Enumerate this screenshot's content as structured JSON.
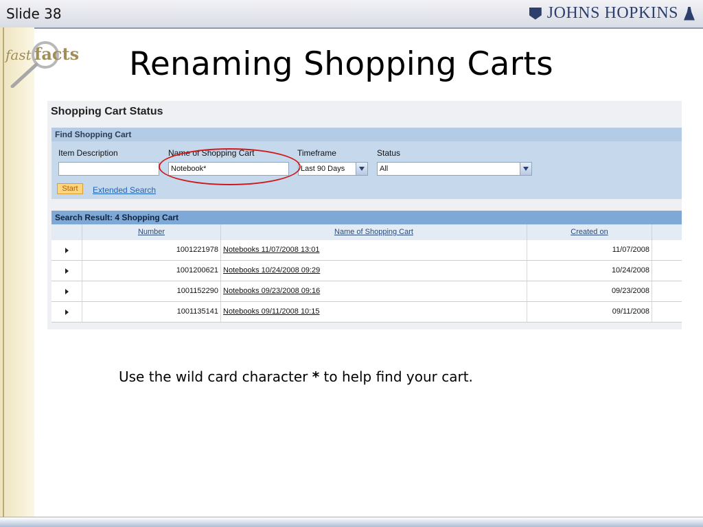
{
  "slide": {
    "number_label": "Slide 38"
  },
  "logo": {
    "text": "JOHNS HOPKINS"
  },
  "fast_facts": {
    "word1": "fast",
    "word2": "facts"
  },
  "title": "Renaming Shopping Carts",
  "panel": {
    "title": "Shopping Cart Status",
    "find": {
      "header": "Find Shopping Cart",
      "labels": {
        "item_description": "Item Description",
        "name_of_cart": "Name of Shopping Cart",
        "timeframe": "Timeframe",
        "status": "Status"
      },
      "values": {
        "item_description": "",
        "name_of_cart": "Notebook*",
        "timeframe": "Last 90 Days",
        "status": "All"
      },
      "start_label": "Start",
      "extended_search_label": "Extended Search"
    },
    "results": {
      "header": "Search Result:  4 Shopping Cart",
      "columns": {
        "number": "Number",
        "name": "Name of Shopping Cart",
        "created": "Created on"
      },
      "rows": [
        {
          "number": "1001221978",
          "name": "Notebooks 11/07/2008 13:01",
          "created": "11/07/2008"
        },
        {
          "number": "1001200621",
          "name": "Notebooks 10/24/2008 09:29",
          "created": "10/24/2008"
        },
        {
          "number": "1001152290",
          "name": "Notebooks 09/23/2008 09:16",
          "created": "09/23/2008"
        },
        {
          "number": "1001135141",
          "name": "Notebooks 09/11/2008 10:15",
          "created": "09/11/2008"
        }
      ]
    }
  },
  "caption": {
    "before": "Use the wild card character ",
    "symbol": "*",
    "after": " to help find your cart."
  },
  "colors": {
    "highlight_ellipse": "#d01a1a",
    "link": "#1f63b5",
    "results_header": "#7ea8d6"
  }
}
